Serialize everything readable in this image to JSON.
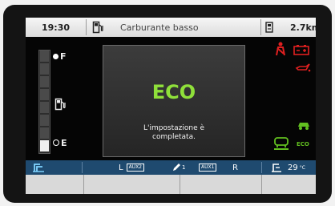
{
  "topbar": {
    "time": "19:30",
    "fuel_icon": "fuel-pump-icon",
    "message": "Carburante basso",
    "trip_icon": "trip-display-icon",
    "range": "2.7km"
  },
  "gauge": {
    "full_label": "F",
    "empty_label": "E",
    "fuel_icon": "fuel-pump-icon",
    "level": 0.1
  },
  "popup": {
    "title": "ECO",
    "message_line1": "L'impostazione è",
    "message_line2": "completata."
  },
  "warnings": {
    "colors": {
      "red": "#e02020",
      "green": "#62c020",
      "popup_green": "#8fe03a"
    },
    "items": [
      "seatbelt-warning-icon",
      "battery-warning-icon",
      "oil-pressure-warning-icon",
      "eco-mode-icon",
      "traction-control-icon"
    ],
    "eco_label": "ECO"
  },
  "bottombar": {
    "left_icon": "compass-mode-icon",
    "left_selector": "L",
    "aux_left": "AUX2",
    "pen_icon": "pen-icon",
    "pen_suffix": "1",
    "aux_right": "AUX1",
    "right_selector": "R",
    "temp_icon": "ambient-temp-icon",
    "temp_value": "29",
    "temp_unit": "°C",
    "accent": "#1f4a6f"
  }
}
